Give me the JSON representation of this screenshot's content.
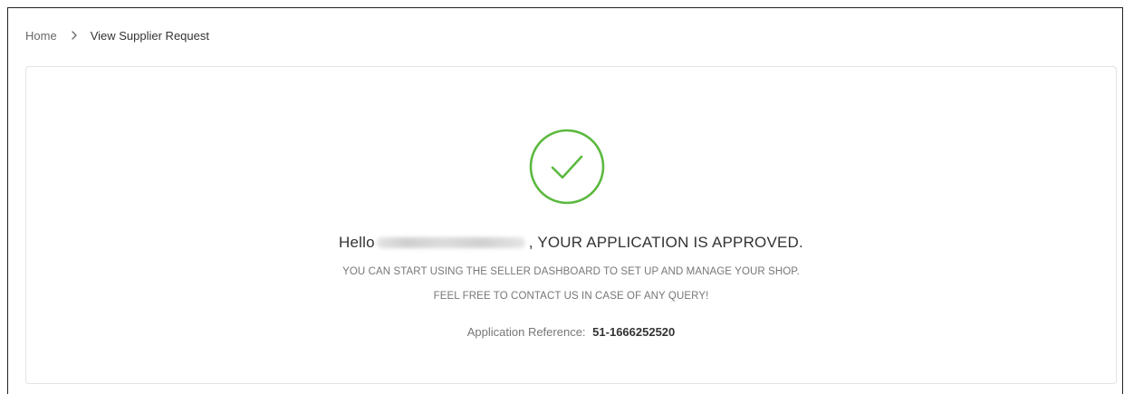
{
  "breadcrumb": {
    "home": "Home",
    "current": "View Supplier Request"
  },
  "confirmation": {
    "icon": "check-circle-icon",
    "accent_color": "#5cb940",
    "greeting": "Hello",
    "status": ", YOUR APPLICATION IS APPROVED.",
    "line1": "YOU CAN START USING THE SELLER DASHBOARD TO SET UP AND MANAGE YOUR SHOP.",
    "line2": "FEEL FREE TO CONTACT US IN CASE OF ANY QUERY!",
    "reference_label": "Application Reference:",
    "reference_value": "51-1666252520"
  }
}
